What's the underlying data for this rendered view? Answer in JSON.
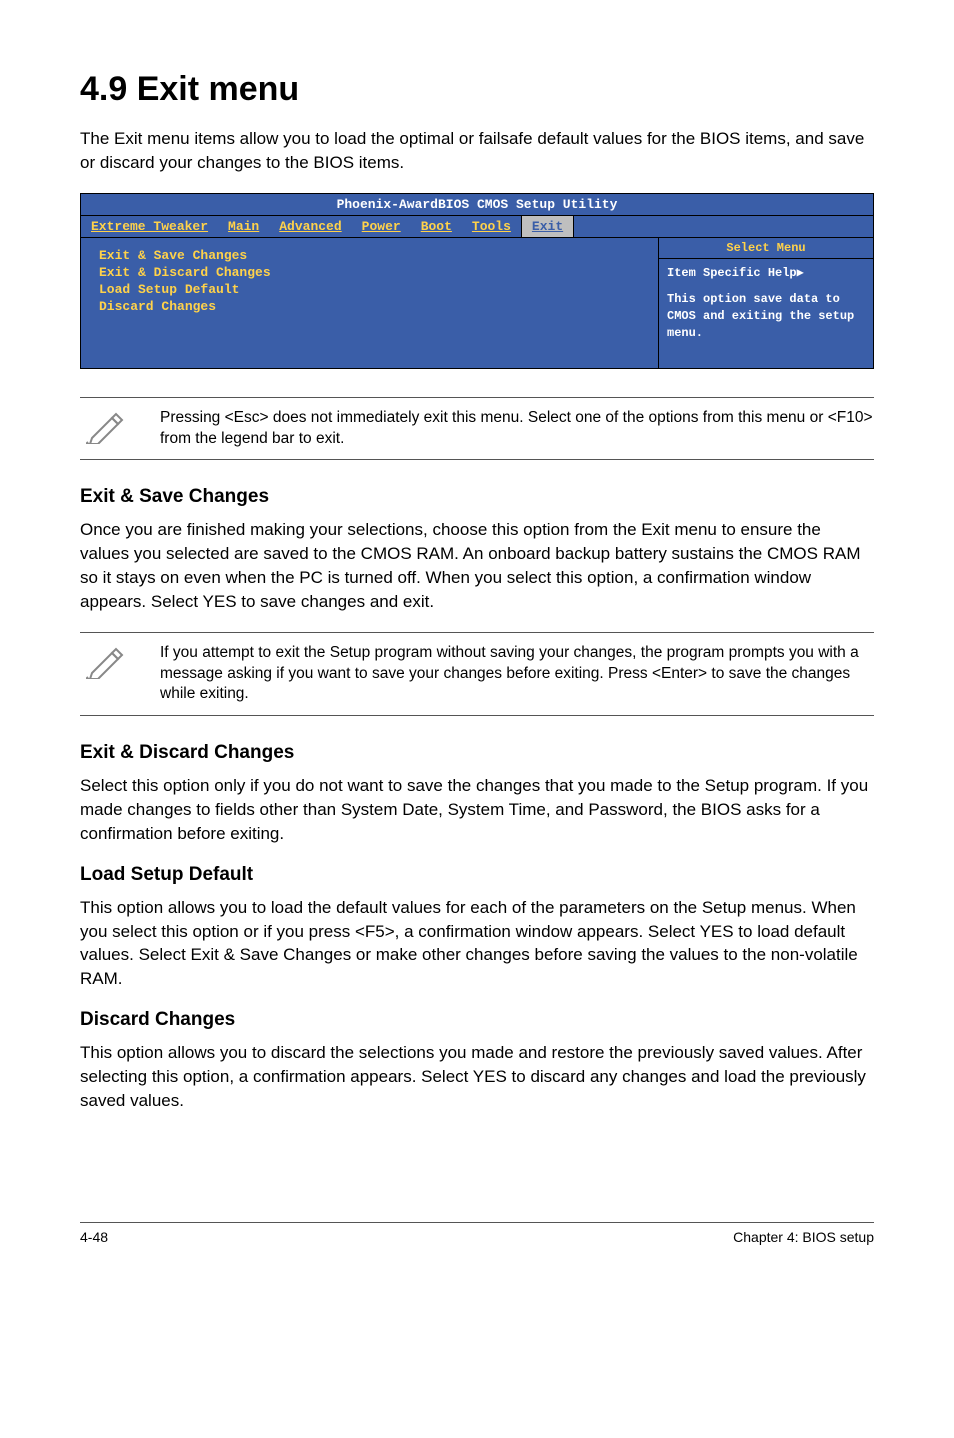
{
  "heading": "4.9    Exit menu",
  "intro": "The Exit menu items allow you to load the optimal or failsafe default values for the BIOS items, and save or discard your changes to the BIOS items.",
  "bios": {
    "title": "Phoenix-AwardBIOS CMOS Setup Utility",
    "menu": [
      "Extreme Tweaker",
      "Main",
      "Advanced",
      "Power",
      "Boot",
      "Tools",
      "Exit"
    ],
    "active_index": 6,
    "items": [
      "Exit & Save Changes",
      "Exit & Discard Changes",
      "Load Setup Default",
      "Discard Changes"
    ],
    "sidebar_title": "Select Menu",
    "help_title": "Item Specific Help▶",
    "help_body": "This option save data to CMOS and exiting the setup menu."
  },
  "note1": "Pressing <Esc> does not immediately exit this menu. Select one of the options from this menu or <F10> from the legend bar to exit.",
  "s1": {
    "title": "Exit & Save Changes",
    "body": "Once you are finished making your selections, choose this option from the Exit menu to ensure the values you selected are saved to the CMOS RAM. An onboard backup battery sustains the CMOS RAM so it stays on even when the PC is turned off. When you select this option, a confirmation window appears. Select YES to save changes and exit."
  },
  "note2": "If you attempt to exit the Setup program without saving your changes, the program prompts you with a message asking if you want to save your changes before exiting. Press <Enter> to save the changes while exiting.",
  "s2": {
    "title": "Exit & Discard Changes",
    "body": "Select this option only if you do not want to save the changes that you made to the Setup program. If you made changes to fields other than System Date, System Time, and Password, the BIOS asks for a confirmation before exiting."
  },
  "s3": {
    "title": "Load Setup Default",
    "body": "This option allows you to load the default values for each of the parameters on the Setup menus. When you select this option or if you press <F5>, a confirmation window appears. Select YES to load default values. Select Exit & Save Changes or make other changes before saving the values to the non-volatile RAM."
  },
  "s4": {
    "title": "Discard Changes",
    "body": "This option allows you to discard the selections you made and restore the previously saved values. After selecting this option, a confirmation appears. Select YES to discard any changes and load the previously saved values."
  },
  "footer": {
    "left": "4-48",
    "right": "Chapter 4: BIOS setup"
  }
}
